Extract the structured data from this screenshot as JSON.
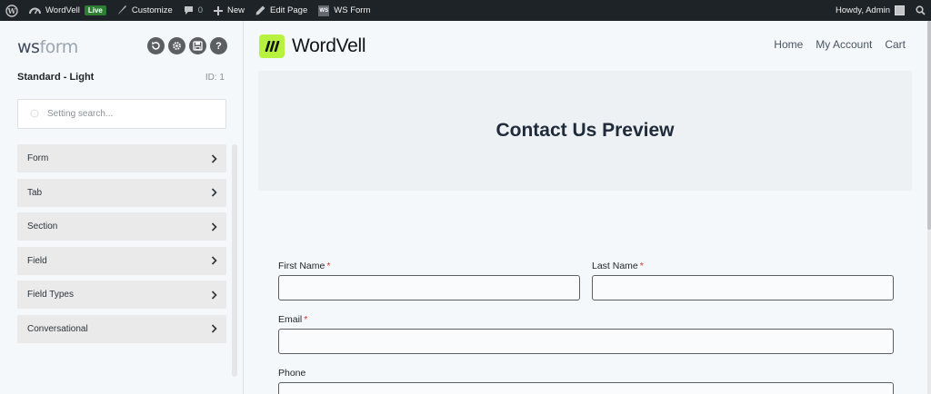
{
  "adminbar": {
    "site_name": "WordVell",
    "live_badge": "Live",
    "customize": "Customize",
    "comments_count": "0",
    "new": "New",
    "edit_page": "Edit Page",
    "ws_form": "WS Form",
    "ws_icon_text": "WS",
    "howdy": "Howdy, Admin"
  },
  "sidebar": {
    "brand_main": "ws",
    "brand_accent": "form",
    "style_name": "Standard - Light",
    "style_id": "ID: 1",
    "search_placeholder": "Setting search...",
    "panels": [
      "Form",
      "Tab",
      "Section",
      "Field",
      "Field Types",
      "Conversational"
    ]
  },
  "site": {
    "title": "WordVell",
    "nav": [
      "Home",
      "My Account",
      "Cart"
    ],
    "hero_title": "Contact Us Preview"
  },
  "form": {
    "first_name": "First Name",
    "last_name": "Last Name",
    "email": "Email",
    "phone": "Phone",
    "required_mark": "*"
  },
  "colors": {
    "adminbar_bg": "#1d2327",
    "logo_accent": "#b7f23e",
    "required": "#d63638",
    "live_badge": "#2e7d32"
  }
}
